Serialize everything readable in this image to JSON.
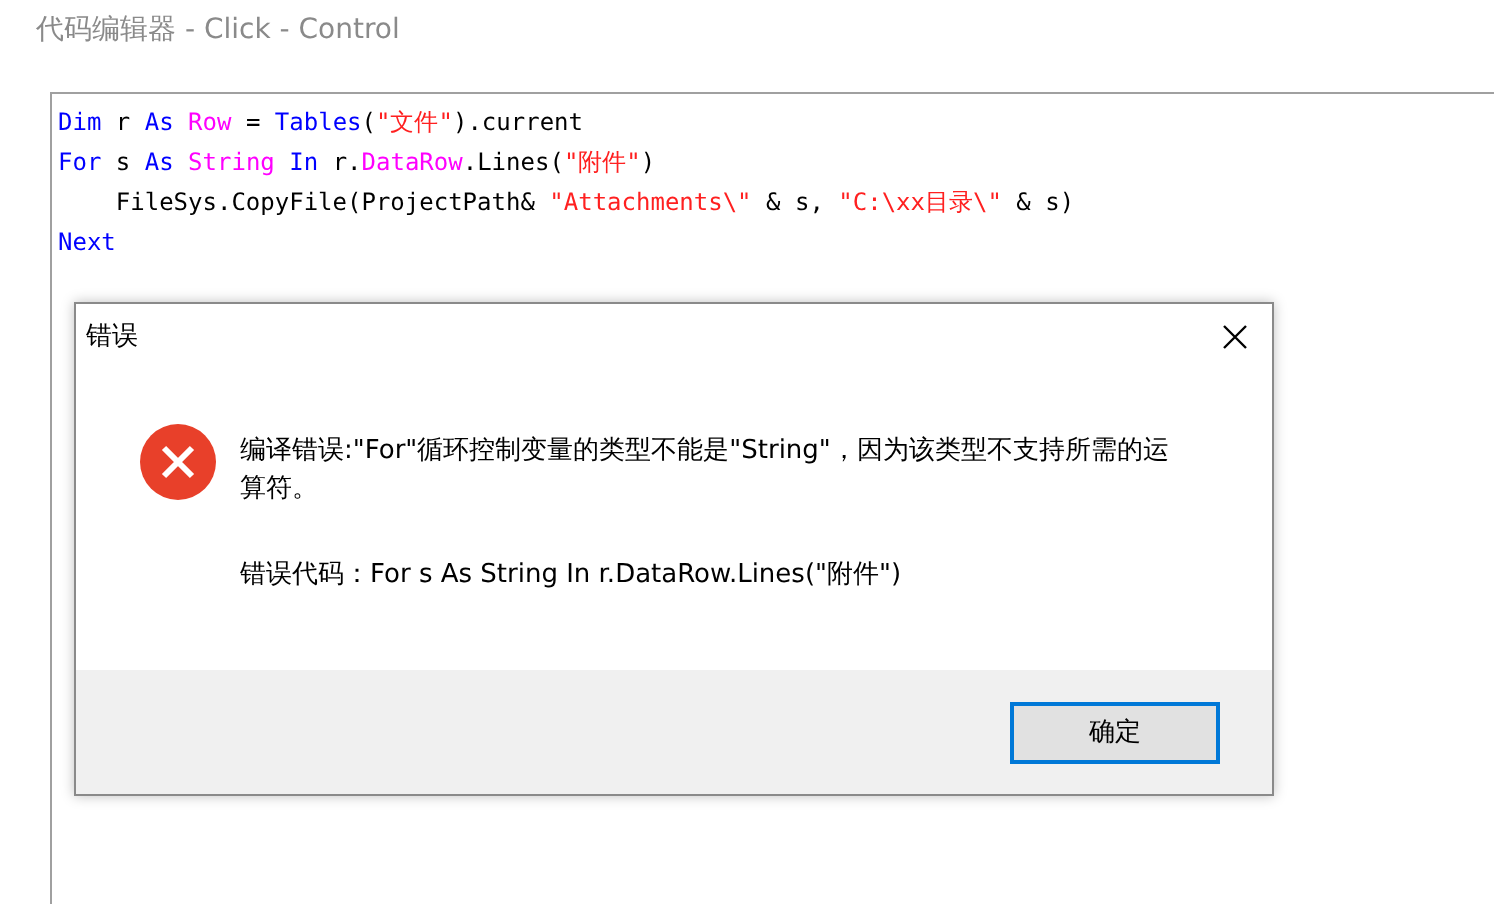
{
  "window": {
    "title": "代码编辑器 - Click - Control"
  },
  "code_lines": [
    [
      {
        "kind": "keyword",
        "text": "Dim"
      },
      {
        "kind": "plain",
        "text": " r "
      },
      {
        "kind": "keyword",
        "text": "As"
      },
      {
        "kind": "type",
        "text": " Row"
      },
      {
        "kind": "plain",
        "text": " = "
      },
      {
        "kind": "keyword",
        "text": "Tables"
      },
      {
        "kind": "plain",
        "text": "("
      },
      {
        "kind": "string",
        "text": "\"文件\""
      },
      {
        "kind": "plain",
        "text": ").current"
      }
    ],
    [
      {
        "kind": "keyword",
        "text": "For"
      },
      {
        "kind": "plain",
        "text": " s "
      },
      {
        "kind": "keyword",
        "text": "As"
      },
      {
        "kind": "type",
        "text": " String"
      },
      {
        "kind": "keyword",
        "text": " In"
      },
      {
        "kind": "plain",
        "text": " r."
      },
      {
        "kind": "type",
        "text": "DataRow"
      },
      {
        "kind": "plain",
        "text": ".Lines("
      },
      {
        "kind": "string",
        "text": "\"附件\""
      },
      {
        "kind": "plain",
        "text": ")"
      }
    ],
    [
      {
        "kind": "plain",
        "text": "    FileSys.CopyFile(ProjectPath& "
      },
      {
        "kind": "string",
        "text": "\"Attachments\\\""
      },
      {
        "kind": "plain",
        "text": " & s, "
      },
      {
        "kind": "string",
        "text": "\"C:\\xx目录\\\""
      },
      {
        "kind": "plain",
        "text": " & s)"
      }
    ],
    [
      {
        "kind": "keyword",
        "text": "Next"
      }
    ]
  ],
  "dialog": {
    "title": "错误",
    "message": "编译错误:\"For\"循环控制变量的类型不能是\"String\"，因为该类型不支持所需的运算符。",
    "error_code": "错误代码：For s As String In r.DataRow.Lines(\"附件\")",
    "buttons": [
      {
        "label": "确定",
        "selected": true
      }
    ]
  }
}
